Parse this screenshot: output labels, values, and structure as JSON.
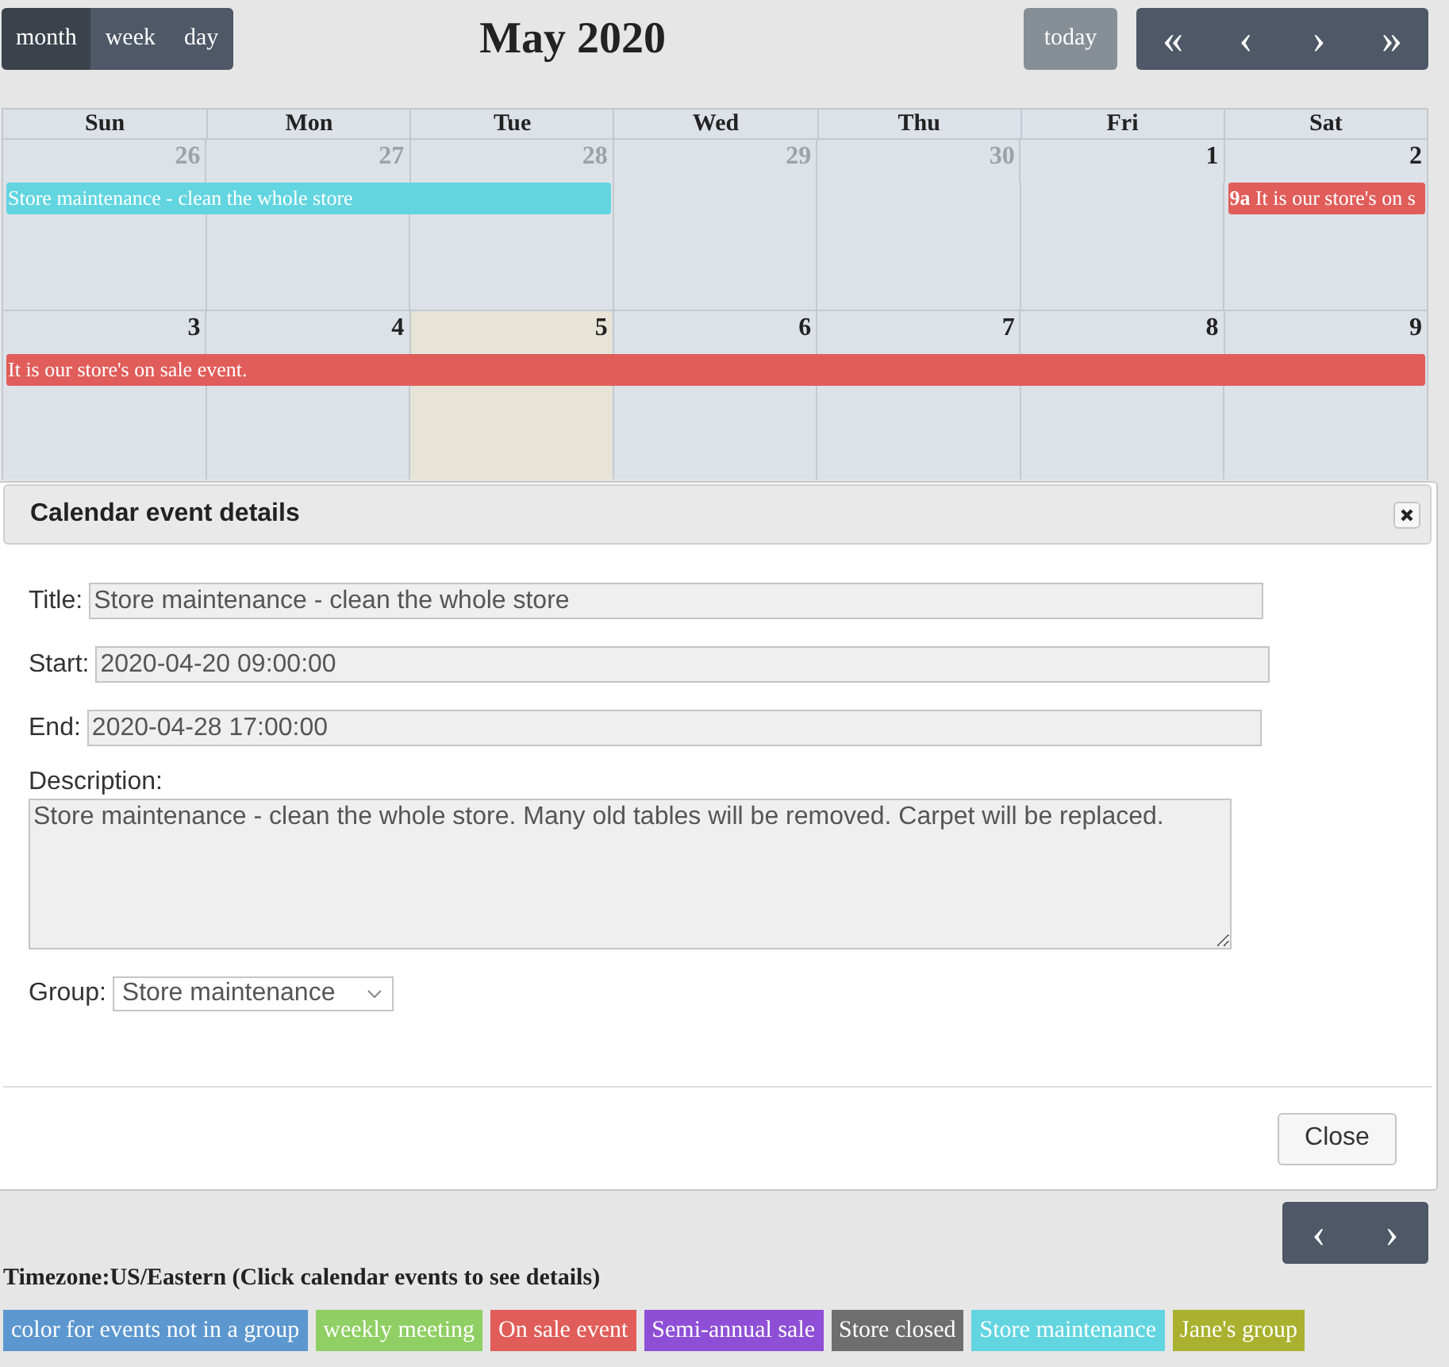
{
  "toolbar": {
    "views": [
      {
        "label": "month",
        "selected": true
      },
      {
        "label": "week",
        "selected": false
      },
      {
        "label": "day",
        "selected": false
      }
    ],
    "title": "May 2020",
    "today_button": "today",
    "nav": [
      "«",
      "‹",
      "›",
      "»"
    ]
  },
  "calendar": {
    "weekdays": [
      "Sun",
      "Mon",
      "Tue",
      "Wed",
      "Thu",
      "Fri",
      "Sat"
    ],
    "weeks": [
      {
        "days": [
          {
            "label": "26",
            "other_month": true,
            "today": false,
            "event": {
              "kind": "start",
              "title": "Store maintenance - clean the whole store",
              "color": "#62d5e0"
            }
          },
          {
            "label": "27",
            "other_month": true,
            "today": false,
            "event": {
              "kind": "continue"
            }
          },
          {
            "label": "28",
            "other_month": true,
            "today": false,
            "event": {
              "kind": "continue"
            }
          },
          {
            "label": "29",
            "other_month": true,
            "today": false
          },
          {
            "label": "30",
            "other_month": true,
            "today": false
          },
          {
            "label": "1",
            "other_month": false,
            "today": false
          },
          {
            "label": "2",
            "other_month": false,
            "today": false,
            "event": {
              "kind": "start",
              "time": "9a",
              "title": "It is our store's on s",
              "color": "#e05d5a"
            }
          }
        ]
      },
      {
        "days": [
          {
            "label": "3",
            "other_month": false,
            "today": false,
            "event": {
              "kind": "start",
              "title": "It is our store's on sale event.",
              "color": "#e05d5a"
            }
          },
          {
            "label": "4",
            "other_month": false,
            "today": false,
            "event": {
              "kind": "continue"
            }
          },
          {
            "label": "5",
            "other_month": false,
            "today": true,
            "event": {
              "kind": "continue"
            }
          },
          {
            "label": "6",
            "other_month": false,
            "today": false,
            "event": {
              "kind": "continue"
            }
          },
          {
            "label": "7",
            "other_month": false,
            "today": false,
            "event": {
              "kind": "continue"
            }
          },
          {
            "label": "8",
            "other_month": false,
            "today": false,
            "event": {
              "kind": "continue"
            }
          },
          {
            "label": "9",
            "other_month": false,
            "today": false,
            "event": {
              "kind": "continue"
            }
          }
        ]
      }
    ]
  },
  "dialog": {
    "title": "Calendar event details",
    "fields": [
      {
        "kind": "text",
        "label": "Title:",
        "value": "Store maintenance - clean the whole store"
      },
      {
        "kind": "text",
        "label": "Start:",
        "value": "2020-04-20 09:00:00"
      },
      {
        "kind": "text",
        "label": "End:",
        "value": "2020-04-28 17:00:00"
      },
      {
        "kind": "textarea",
        "label": "Description:",
        "value": "Store maintenance - clean the whole store. Many old tables will be removed. Carpet will be replaced."
      },
      {
        "kind": "select",
        "label": "Group:",
        "value": "Store maintenance"
      }
    ],
    "close_button": "Close"
  },
  "bottom_nav": [
    "‹",
    "›"
  ],
  "timezone": "Timezone:US/Eastern (Click calendar events to see details)",
  "legend": [
    {
      "label": "color for events not in a group",
      "color": "#5c97cf"
    },
    {
      "label": "weekly meeting",
      "color": "#8fcf63"
    },
    {
      "label": "On sale event",
      "color": "#e05d5a"
    },
    {
      "label": "Semi-annual sale",
      "color": "#8e4fd6"
    },
    {
      "label": "Store closed",
      "color": "#6e6e6e"
    },
    {
      "label": "Store maintenance",
      "color": "#62d5e0"
    },
    {
      "label": "Jane's group",
      "color": "#a9b12e"
    }
  ]
}
